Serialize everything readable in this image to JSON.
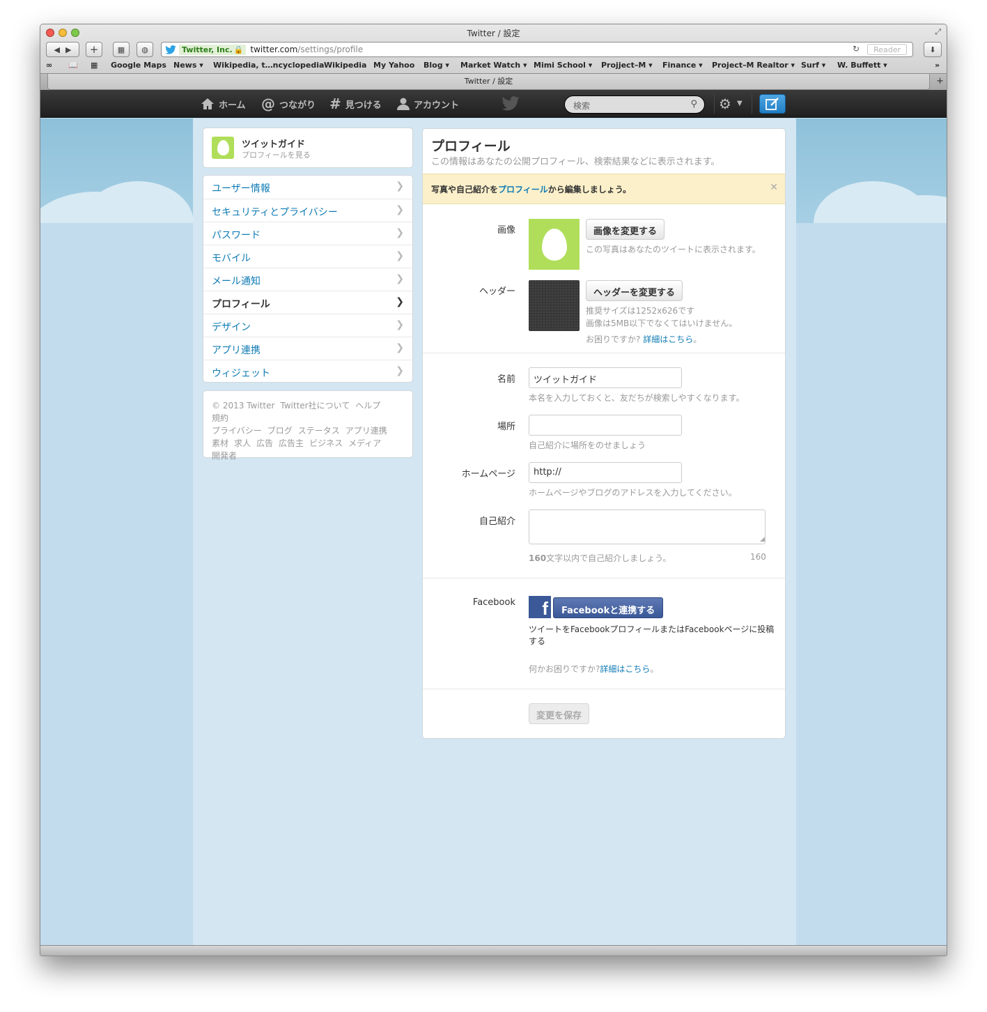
{
  "window": {
    "title": "Twitter / 設定",
    "tab_title": "Twitter / 設定",
    "reader": "Reader"
  },
  "address": {
    "ev_label": "Twitter, Inc.",
    "host": "twitter.com",
    "path": "/settings/profile"
  },
  "bookmarks": [
    "Google Maps",
    "News ▾",
    "Wikipedia, t…ncyclopedia",
    "Wikipedia",
    "My Yahoo",
    "Blog ▾",
    "Market Watch ▾",
    "Mimi School ▾",
    "Projject–M ▾",
    "Finance ▾",
    "Project–M Realtor ▾",
    "Surf ▾",
    "W. Buffett ▾"
  ],
  "topnav": {
    "home": "ホーム",
    "connect": "つながり",
    "discover": "見つける",
    "account": "アカウント",
    "search_placeholder": "検索"
  },
  "profile_card": {
    "name": "ツイットガイド",
    "link": "プロフィールを見る"
  },
  "menu": [
    {
      "label": "ユーザー情報"
    },
    {
      "label": "セキュリティとプライバシー"
    },
    {
      "label": "パスワード"
    },
    {
      "label": "モバイル"
    },
    {
      "label": "メール通知"
    },
    {
      "label": "プロフィール",
      "active": true
    },
    {
      "label": "デザイン"
    },
    {
      "label": "アプリ連携"
    },
    {
      "label": "ウィジェット"
    }
  ],
  "footer_links": [
    "© 2013 Twitter",
    "Twitter社について",
    "ヘルプ",
    "規約",
    "プライバシー",
    "ブログ",
    "ステータス",
    "アプリ連携",
    "素材",
    "求人",
    "広告",
    "広告主",
    "ビジネス",
    "メディア",
    "開発者"
  ],
  "main": {
    "title": "プロフィール",
    "subtitle": "この情報はあなたの公開プロフィール、検索結果などに表示されます。",
    "alert": {
      "pre": "写真や自己紹介を",
      "link": "プロフィール",
      "post": "から編集しましょう。"
    },
    "image": {
      "label": "画像",
      "button": "画像を変更する",
      "help": "この写真はあなたのツイートに表示されます。"
    },
    "header": {
      "label": "ヘッダー",
      "button": "ヘッダーを変更する",
      "help1": "推奨サイズは1252x626です",
      "help2": "画像は5MB以下でなくてはいけません。",
      "help3_pre": "お困りですか?",
      "help3_link": "詳細はこちら",
      "help3_post": "。"
    },
    "name": {
      "label": "名前",
      "value": "ツイットガイド",
      "help": "本名を入力しておくと、友だちが検索しやすくなります。"
    },
    "location": {
      "label": "場所",
      "value": "",
      "help": "自己紹介に場所をのせましょう"
    },
    "homepage": {
      "label": "ホームページ",
      "value": "http://",
      "help": "ホームページやブログのアドレスを入力してください。"
    },
    "bio": {
      "label": "自己紹介",
      "value": "",
      "help_num": "160",
      "help_text": "文字以内で自己紹介しましょう。",
      "counter": "160"
    },
    "facebook": {
      "label": "Facebook",
      "button": "Facebookと連携する",
      "desc1": "ツイートをFacebookプロフィールまたはFacebookページに投稿",
      "desc2": "する",
      "help_pre": "何かお困りですか?",
      "help_link": "詳細はこちら",
      "help_post": "。"
    },
    "save": "変更を保存"
  },
  "colors": {
    "link": "#0f7bb4",
    "egg_green": "#b0de5a",
    "alert_bg": "#fcf0ca",
    "facebook": "#3b5998"
  }
}
